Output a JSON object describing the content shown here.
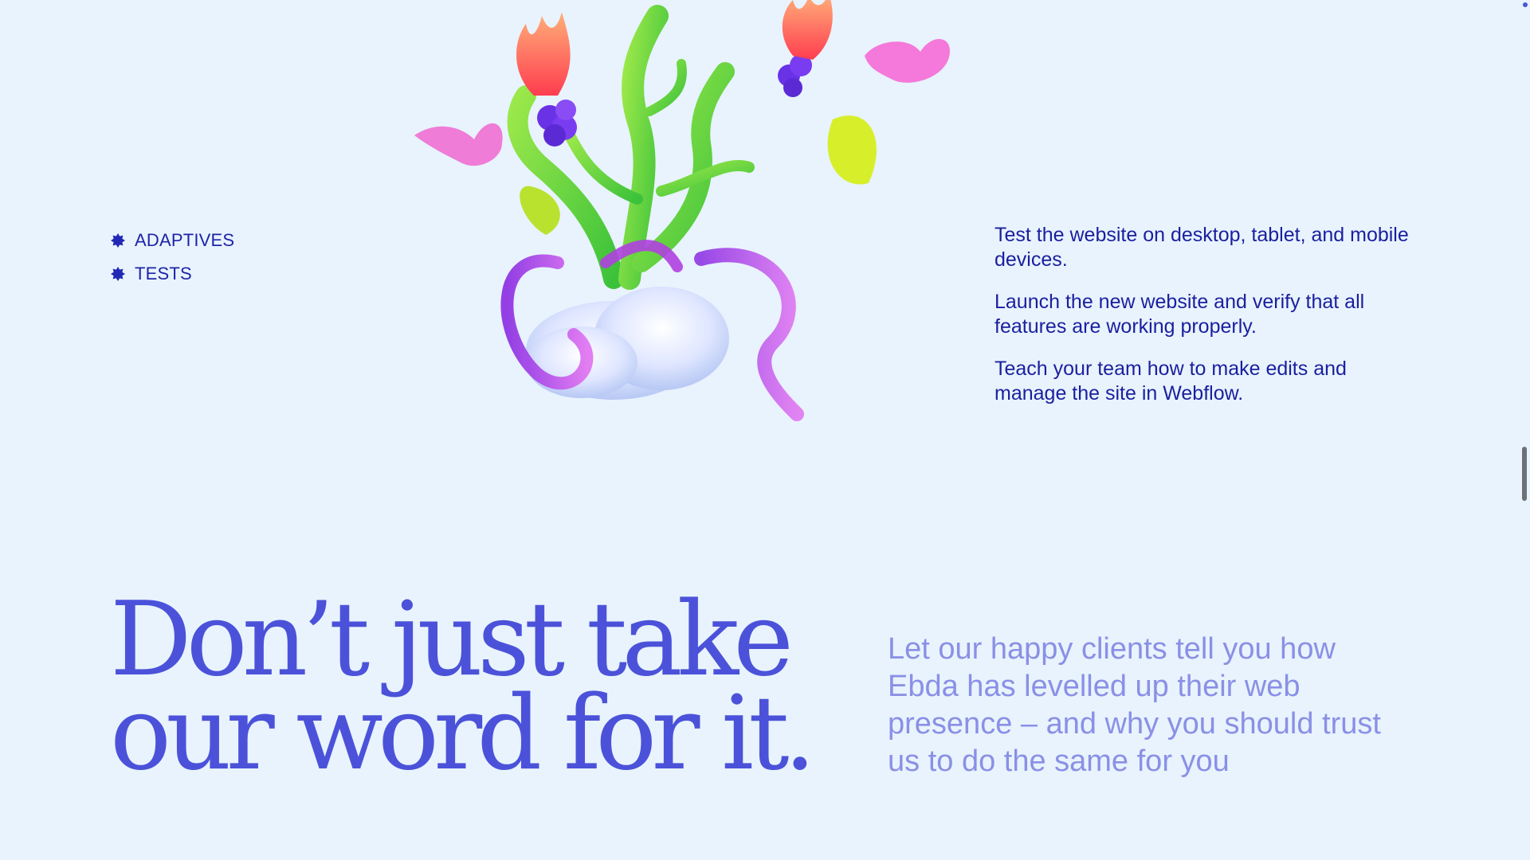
{
  "tags": [
    {
      "label": "ADAPTIVES",
      "icon": "badge-star-icon"
    },
    {
      "label": "TESTS",
      "icon": "badge-star-icon"
    }
  ],
  "steps": [
    "Test the website on desktop, tablet, and mobile devices.",
    "Launch the new website and verify that all features are working properly.",
    "Teach your team how to make edits and manage the site in Webflow."
  ],
  "headline": {
    "line1": "Don’t just take",
    "line2": "our word for it."
  },
  "subcopy": "Let our happy clients tell you how Ebda has levelled up their web presence – and why you should trust us to do the same for you",
  "colors": {
    "background": "#e8f3fd",
    "text_primary": "#1b1f9e",
    "headline": "#4b52d9",
    "subcopy": "#8a90e6",
    "scrollbar_thumb": "#6d7075"
  }
}
